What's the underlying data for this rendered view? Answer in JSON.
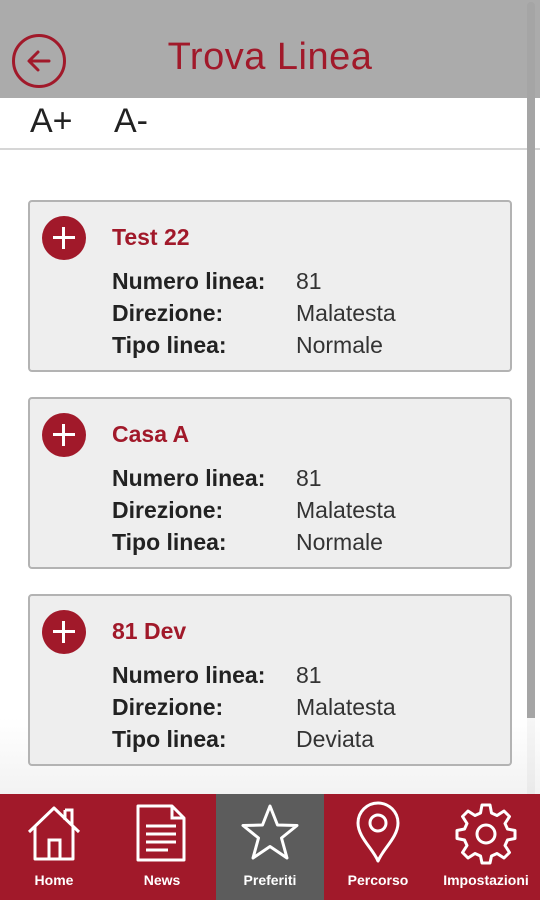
{
  "header": {
    "title": "Trova Linea"
  },
  "font_controls": {
    "increase": "A+",
    "decrease": "A-"
  },
  "cards": [
    {
      "name": "Test 22",
      "rows": [
        {
          "label": "Numero linea:",
          "value": "81"
        },
        {
          "label": "Direzione:",
          "value": "Malatesta"
        },
        {
          "label": "Tipo linea:",
          "value": "Normale"
        }
      ]
    },
    {
      "name": "Casa A",
      "rows": [
        {
          "label": "Numero linea:",
          "value": "81"
        },
        {
          "label": "Direzione:",
          "value": "Malatesta"
        },
        {
          "label": "Tipo linea:",
          "value": "Normale"
        }
      ]
    },
    {
      "name": "81 Dev",
      "rows": [
        {
          "label": "Numero linea:",
          "value": "81"
        },
        {
          "label": "Direzione:",
          "value": "Malatesta"
        },
        {
          "label": "Tipo linea:",
          "value": "Deviata"
        }
      ]
    }
  ],
  "nav": [
    {
      "label": "Home",
      "icon": "home-icon",
      "active": false
    },
    {
      "label": "News",
      "icon": "news-icon",
      "active": false
    },
    {
      "label": "Preferiti",
      "icon": "star-icon",
      "active": true
    },
    {
      "label": "Percorso",
      "icon": "location-pin-icon",
      "active": false
    },
    {
      "label": "Impostazioni",
      "icon": "gear-icon",
      "active": false
    }
  ],
  "colors": {
    "accent": "#a1192a",
    "header_bg": "#ababab",
    "nav_active": "#5c5c5c",
    "card_bg": "#eeeeee"
  }
}
